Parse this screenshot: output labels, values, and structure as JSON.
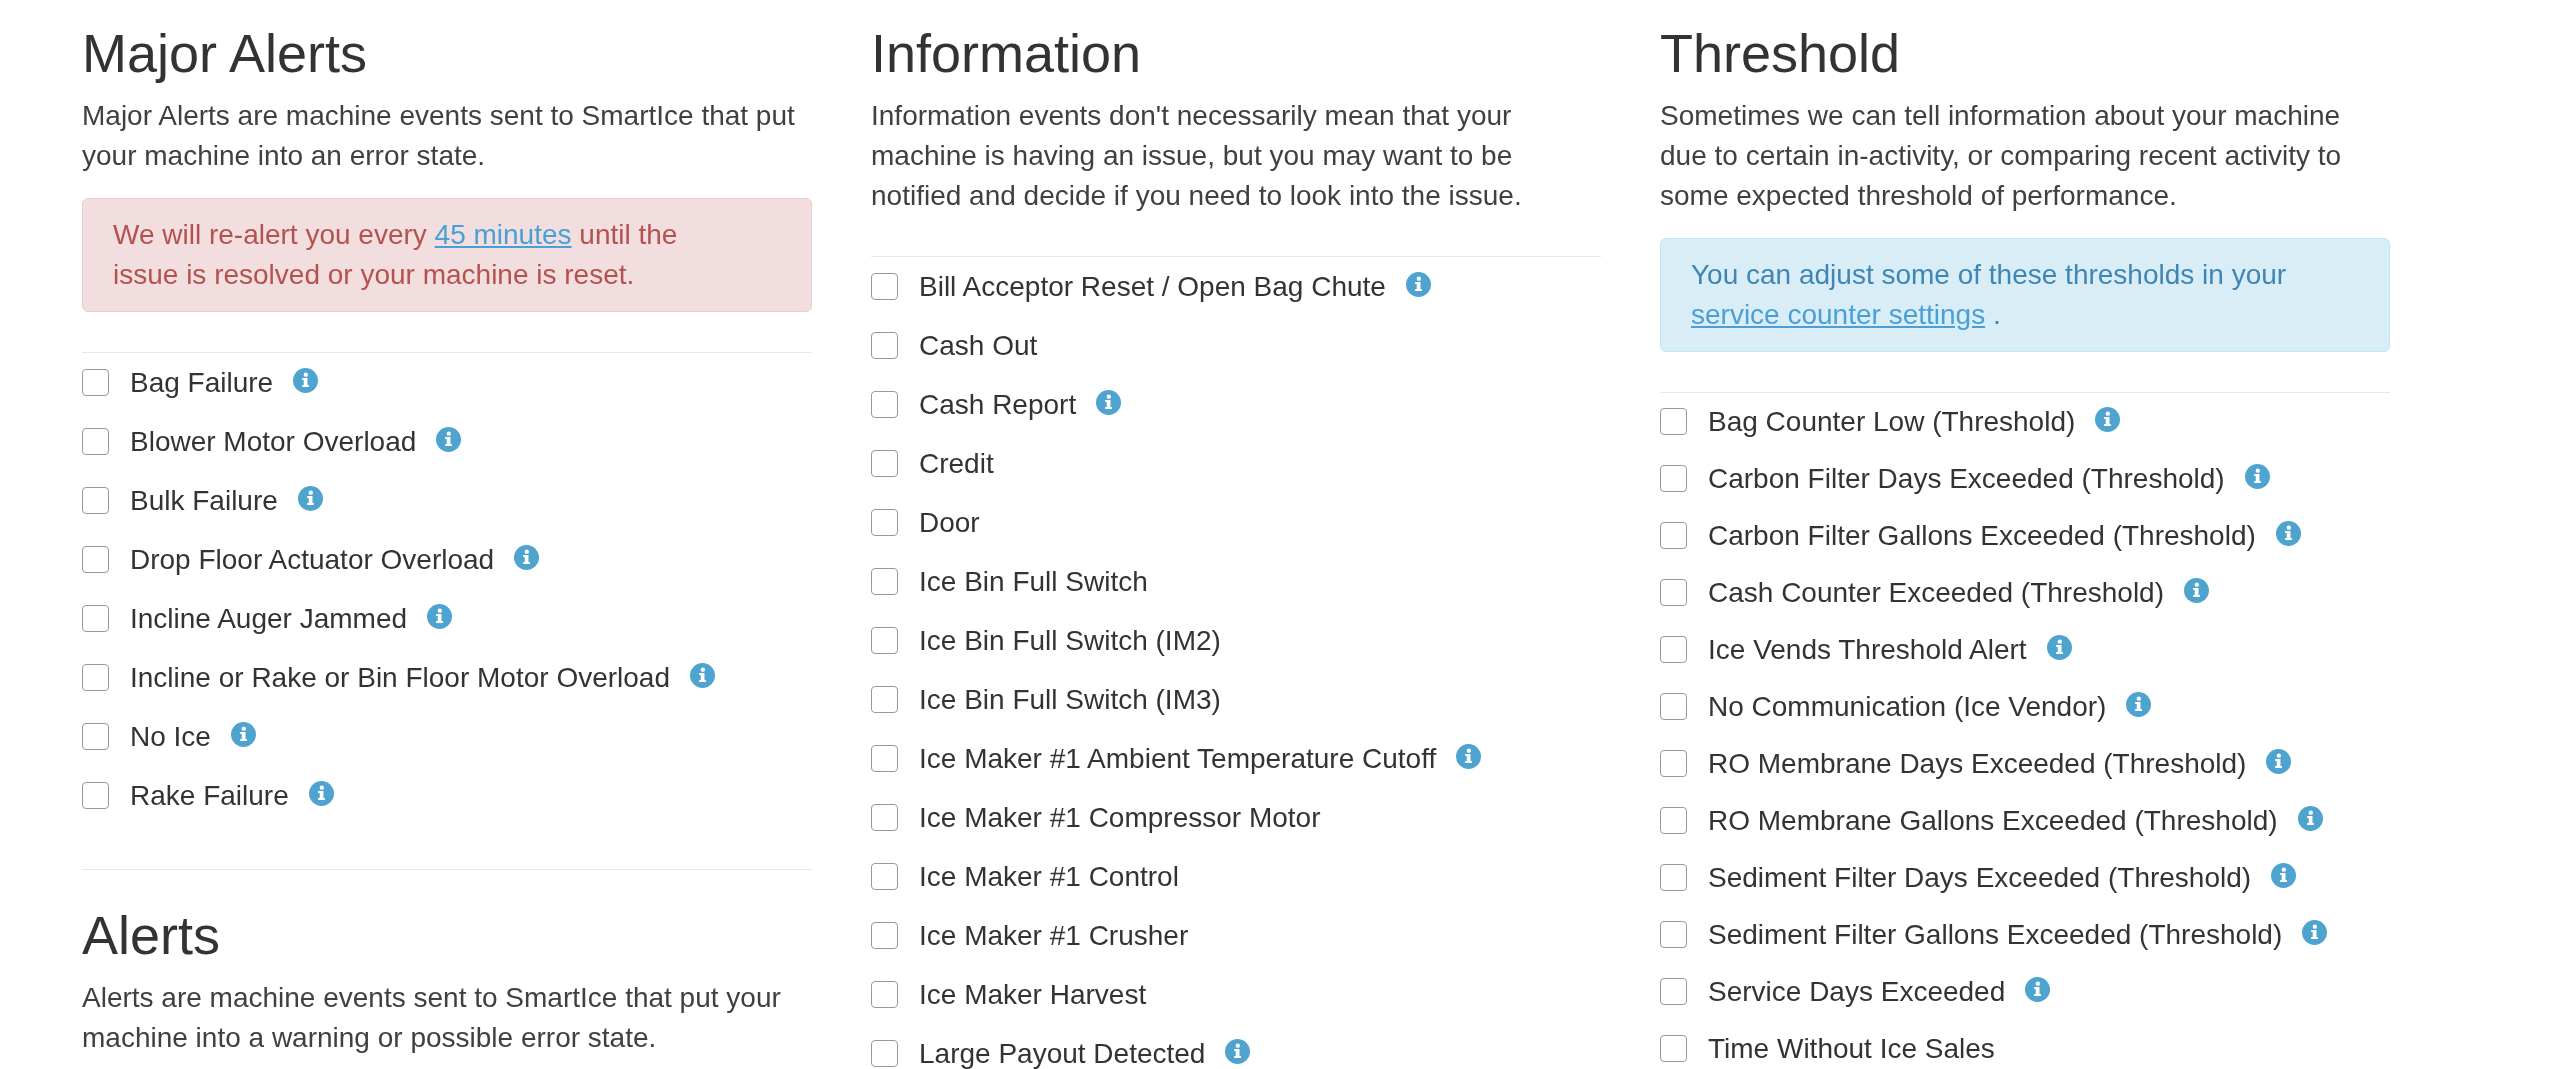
{
  "columns": [
    {
      "sections": [
        {
          "title": "Major Alerts",
          "description": "Major Alerts are machine events sent to SmartIce that put your machine into an error state.",
          "notice": {
            "kind": "danger",
            "text": "We will re-alert you every",
            "link": "45 minutes",
            "text_after": "until the issue is resolved or your machine is reset."
          },
          "events": [
            {
              "label": "Bag Failure",
              "checked": false,
              "info": true
            },
            {
              "label": "Blower Motor Overload",
              "checked": false,
              "info": true
            },
            {
              "label": "Bulk Failure",
              "checked": false,
              "info": true
            },
            {
              "label": "Drop Floor Actuator Overload",
              "checked": false,
              "info": true
            },
            {
              "label": "Incline Auger Jammed",
              "checked": false,
              "info": true
            },
            {
              "label": "Incline or Rake or Bin Floor Motor Overload",
              "checked": false,
              "info": true
            },
            {
              "label": "No Ice",
              "checked": false,
              "info": true
            },
            {
              "label": "Rake Failure",
              "checked": false,
              "info": true
            }
          ]
        },
        {
          "title": "Alerts",
          "description": "Alerts are machine events sent to SmartIce that put your machine into a warning or possible error state."
        }
      ]
    },
    {
      "sections": [
        {
          "title": "Information",
          "description": "Information events don't necessarily mean that your machine is having an issue, but you may want to be notified and decide if you need to look into the issue.",
          "events": [
            {
              "label": "Bill Acceptor Reset / Open Bag Chute",
              "checked": false,
              "info": true
            },
            {
              "label": "Cash Out",
              "checked": false,
              "info": false
            },
            {
              "label": "Cash Report",
              "checked": false,
              "info": true
            },
            {
              "label": "Credit",
              "checked": false,
              "info": false
            },
            {
              "label": "Door",
              "checked": false,
              "info": false
            },
            {
              "label": "Ice Bin Full Switch",
              "checked": false,
              "info": false
            },
            {
              "label": "Ice Bin Full Switch (IM2)",
              "checked": false,
              "info": false
            },
            {
              "label": "Ice Bin Full Switch (IM3)",
              "checked": false,
              "info": false
            },
            {
              "label": "Ice Maker #1 Ambient Temperature Cutoff",
              "checked": false,
              "info": true
            },
            {
              "label": "Ice Maker #1 Compressor Motor",
              "checked": false,
              "info": false
            },
            {
              "label": "Ice Maker #1 Control",
              "checked": false,
              "info": false
            },
            {
              "label": "Ice Maker #1 Crusher",
              "checked": false,
              "info": false
            },
            {
              "label": "Ice Maker Harvest",
              "checked": false,
              "info": false
            },
            {
              "label": "Large Payout Detected",
              "checked": false,
              "info": true
            }
          ]
        }
      ]
    },
    {
      "sections": [
        {
          "title": "Threshold",
          "description": "Sometimes we can tell information about your machine due to certain in-activity, or comparing recent activity to some expected threshold of performance.",
          "notice": {
            "kind": "info",
            "text": "You can adjust some of these thresholds in your",
            "link": "service counter settings",
            "text_after": "."
          },
          "events": [
            {
              "label": "Bag Counter Low (Threshold)",
              "checked": false,
              "info": true
            },
            {
              "label": "Carbon Filter Days Exceeded (Threshold)",
              "checked": false,
              "info": true
            },
            {
              "label": "Carbon Filter Gallons Exceeded (Threshold)",
              "checked": false,
              "info": true
            },
            {
              "label": "Cash Counter Exceeded (Threshold)",
              "checked": false,
              "info": true
            },
            {
              "label": "Ice Vends Threshold Alert",
              "checked": false,
              "info": true
            },
            {
              "label": "No Communication (Ice Vendor)",
              "checked": false,
              "info": true
            },
            {
              "label": "RO Membrane Days Exceeded (Threshold)",
              "checked": false,
              "info": true
            },
            {
              "label": "RO Membrane Gallons Exceeded (Threshold)",
              "checked": false,
              "info": true
            },
            {
              "label": "Sediment Filter Days Exceeded (Threshold)",
              "checked": false,
              "info": true
            },
            {
              "label": "Sediment Filter Gallons Exceeded (Threshold)",
              "checked": false,
              "info": true
            },
            {
              "label": "Service Days Exceeded",
              "checked": false,
              "info": true
            },
            {
              "label": "Time Without Ice Sales",
              "checked": false,
              "info": false
            }
          ]
        }
      ]
    }
  ]
}
